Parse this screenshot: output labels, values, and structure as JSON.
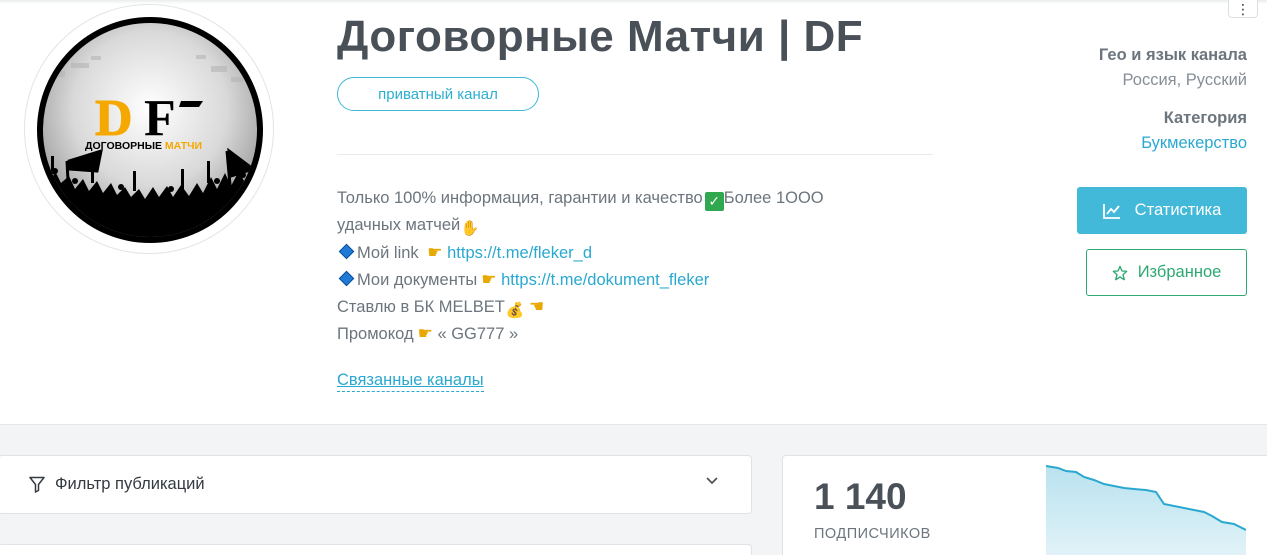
{
  "channel": {
    "title": "Договорные Матчи | DF",
    "badge": "приватный канал",
    "logo_text": "DF",
    "logo_subtitle": "ДОГОВОРНЫЕ МАТЧИ"
  },
  "description": {
    "line1": "Только 100% информация, гарантии и качество",
    "line1_tail": "Более 1ООО",
    "line2": "удачных матчей",
    "link1_label": "Мой link",
    "link1_url": "https://t.me/fleker_d",
    "link2_label": "Мои документы",
    "link2_url": "https://t.me/dokument_fleker",
    "line5": "Ставлю в БК MELBET",
    "line6_label": "Промокод",
    "line6_code": "« GG777 »"
  },
  "related_link": "Связанные каналы",
  "meta": {
    "geo_label": "Гео и язык канала",
    "geo_value": "Россия, Русский",
    "category_label": "Категория",
    "category_value": "Букмекерство"
  },
  "buttons": {
    "stats": "Статистика",
    "favorite": "Избранное",
    "more": "⋮"
  },
  "filter": {
    "label": "Фильтр публикаций"
  },
  "subscribers": {
    "count": "1 140",
    "label": "ПОДПИСЧИКОВ"
  },
  "colors": {
    "accent": "#43b9d9",
    "link": "#2aa8cf",
    "favorite": "#2ea873",
    "logo_orange": "#f5a800"
  },
  "icons": {
    "stats": "chart-line-icon",
    "favorite": "star-icon",
    "filter": "funnel-icon",
    "expand": "chevron-down-icon",
    "more": "kebab-menu-icon"
  }
}
